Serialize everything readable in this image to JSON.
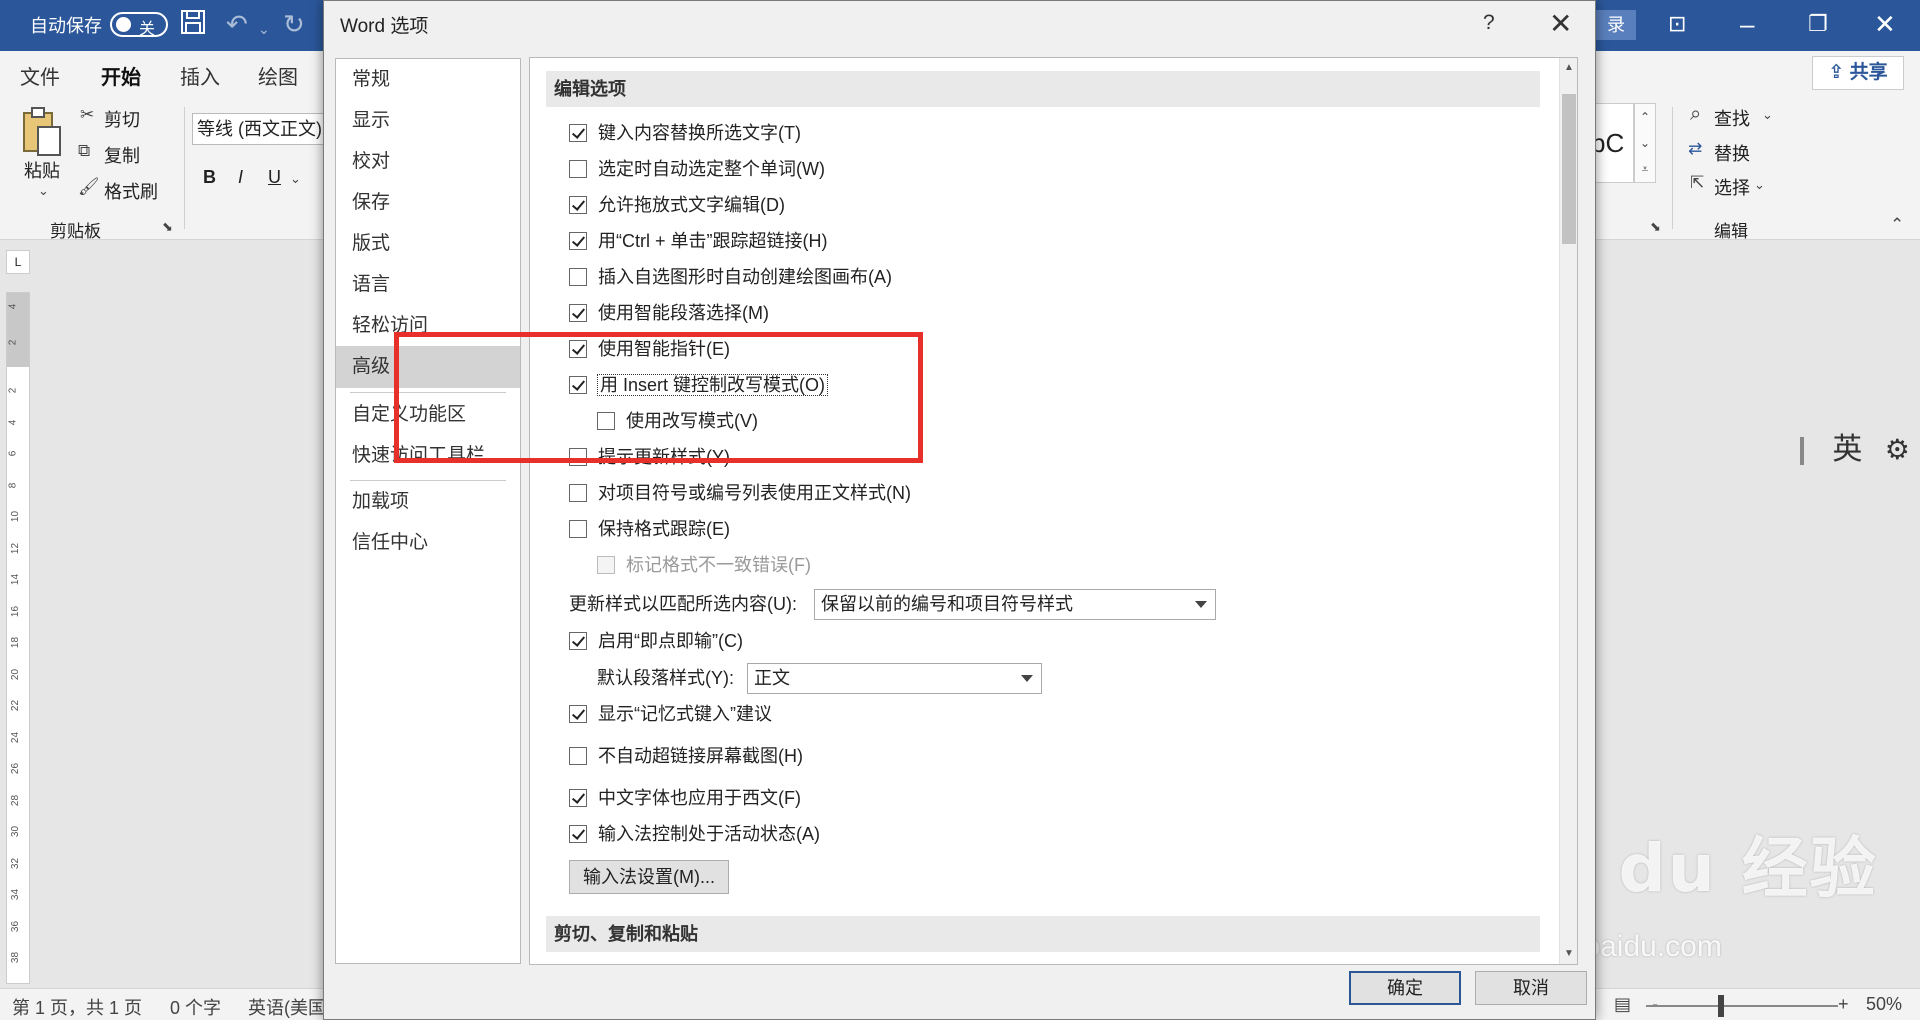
{
  "word": {
    "autosave_label": "自动保存",
    "autosave_state": "关",
    "login_partial": "录",
    "tabs": [
      "文件",
      "开始",
      "插入",
      "绘图"
    ],
    "active_tab": "开始",
    "share_label": "共享",
    "clipboard": {
      "paste": "粘贴",
      "cut": "剪切",
      "copy": "复制",
      "format_painter": "格式刷",
      "group_label": "剪贴板"
    },
    "font_name": "等线 (西文正文)",
    "format_buttons": [
      "B",
      "I",
      "U"
    ],
    "style_preview": "bC",
    "editing": {
      "find": "查找",
      "replace": "替换",
      "select": "选择",
      "group_label": "编辑"
    },
    "ime": "英",
    "ruler_corner": "L",
    "ruler_numbers": [
      "4",
      "2",
      "2",
      "4",
      "6",
      "8",
      "10",
      "12",
      "14",
      "16",
      "18",
      "20",
      "22",
      "24",
      "26",
      "28",
      "30",
      "32",
      "34",
      "36",
      "38"
    ],
    "status": {
      "page": "第 1 页，共 1 页",
      "words": "0 个字",
      "language": "英语(美国",
      "zoom_minus": "-",
      "zoom_plus": "+",
      "zoom": "50%",
      "zoom_level_percent": 50
    },
    "watermark_main": "Bai du 经验",
    "watermark_sub": "jingyan.baidu.com"
  },
  "dialog": {
    "title": "Word 选项",
    "help": "?",
    "close": "✕",
    "nav": [
      {
        "label": "常规"
      },
      {
        "label": "显示"
      },
      {
        "label": "校对"
      },
      {
        "label": "保存"
      },
      {
        "label": "版式"
      },
      {
        "label": "语言"
      },
      {
        "label": "轻松访问"
      },
      {
        "label": "高级"
      },
      {
        "label": "自定义功能区"
      },
      {
        "label": "快速访问工具栏"
      },
      {
        "label": "加载项"
      },
      {
        "label": "信任中心"
      }
    ],
    "selected_nav": "高级",
    "section_editing": "编辑选项",
    "options": [
      {
        "label": "键入内容替换所选文字(T)",
        "checked": true
      },
      {
        "label": "选定时自动选定整个单词(W)",
        "checked": false
      },
      {
        "label": "允许拖放式文字编辑(D)",
        "checked": true
      },
      {
        "label": "用“Ctrl + 单击”跟踪超链接(H)",
        "checked": true
      },
      {
        "label": "插入自选图形时自动创建绘图画布(A)",
        "checked": false
      },
      {
        "label": "使用智能段落选择(M)",
        "checked": true
      },
      {
        "label": "使用智能指针(E)",
        "checked": true
      },
      {
        "label": "用 Insert 键控制改写模式(O)",
        "checked": true
      },
      {
        "label": "使用改写模式(V)",
        "checked": false
      },
      {
        "label": "提示更新样式(Y)",
        "checked": false
      },
      {
        "label": "对项目符号或编号列表使用正文样式(N)",
        "checked": false
      },
      {
        "label": "保持格式跟踪(E)",
        "checked": false
      },
      {
        "label": "标记格式不一致错误(F)",
        "checked": false,
        "disabled": true
      }
    ],
    "update_style_label": "更新样式以匹配所选内容(U):",
    "update_style_value": "保留以前的编号和项目符号样式",
    "click_and_type": {
      "label": "启用“即点即输”(C)",
      "checked": true
    },
    "default_para_label": "默认段落样式(Y):",
    "default_para_value": "正文",
    "options2": [
      {
        "label": "显示“记忆式键入”建议",
        "checked": true
      },
      {
        "label": "不自动超链接屏幕截图(H)",
        "checked": false
      },
      {
        "label": "中文字体也应用于西文(F)",
        "checked": true
      },
      {
        "label": "输入法控制处于活动状态(A)",
        "checked": true
      }
    ],
    "ime_settings_button": "输入法设置(M)...",
    "section_cut_copy": "剪切、复制和粘贴",
    "ok": "确定",
    "cancel": "取消",
    "scroll_up": "▲",
    "scroll_down": "▼",
    "highlight_color": "#e8302a"
  }
}
